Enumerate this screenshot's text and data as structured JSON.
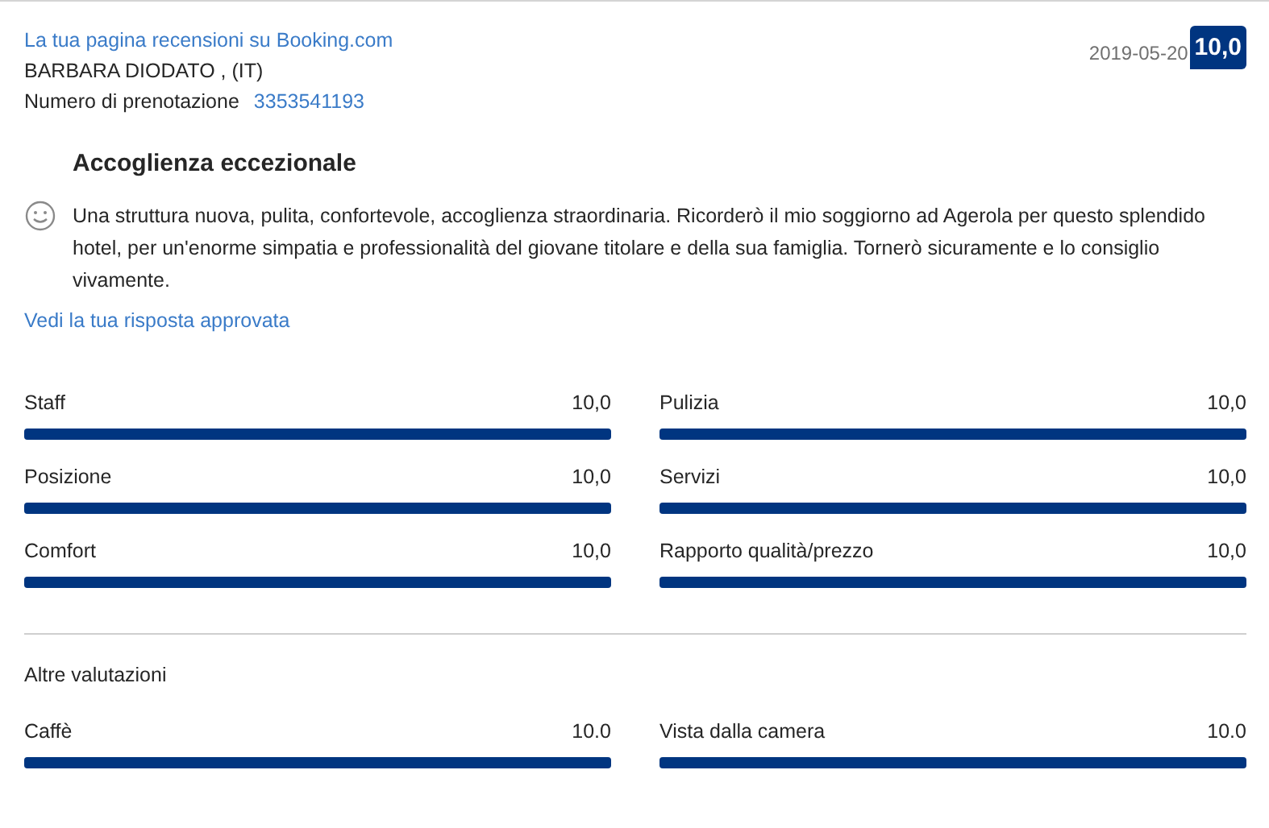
{
  "header": {
    "page_link": "La tua pagina recensioni su Booking.com",
    "guest": "BARBARA DIODATO , (IT)",
    "booking_label": "Numero di prenotazione",
    "booking_number": "3353541193",
    "date": "2019-05-20",
    "score": "10,0"
  },
  "review": {
    "title": "Accoglienza eccezionale",
    "text": "Una struttura nuova, pulita, confortevole, accoglienza straordinaria. Ricorderò il mio soggiorno ad Agerola per questo splendido hotel, per un'enorme simpatia e professionalità del giovane titolare e della sua famiglia. Tornerò sicuramente e lo consiglio vivamente."
  },
  "response_link": "Vedi la tua risposta approvata",
  "ratings": [
    {
      "label": "Staff",
      "value": "10,0",
      "level": 1
    },
    {
      "label": "Pulizia",
      "value": "10,0",
      "level": 1
    },
    {
      "label": "Posizione",
      "value": "10,0",
      "level": 1
    },
    {
      "label": "Servizi",
      "value": "10,0",
      "level": 1
    },
    {
      "label": "Comfort",
      "value": "10,0",
      "level": 1
    },
    {
      "label": "Rapporto qualità/prezzo",
      "value": "10,0",
      "level": 1
    }
  ],
  "other_title": "Altre valutazioni",
  "other_ratings": [
    {
      "label": "Caffè",
      "value": "10.0",
      "level": 1
    },
    {
      "label": "Vista dalla camera",
      "value": "10.0",
      "level": 1
    }
  ]
}
